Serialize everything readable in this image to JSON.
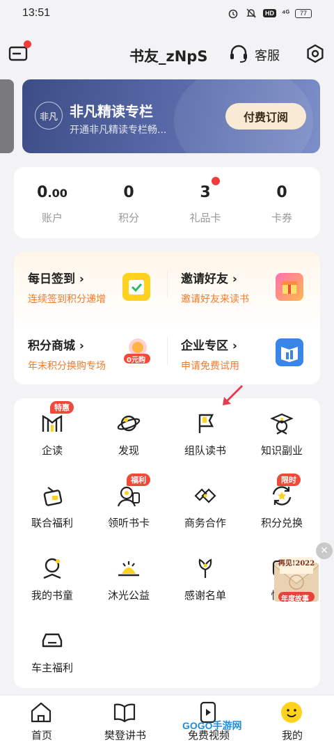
{
  "status_bar": {
    "time": "13:51",
    "signal": "⁴ᴳ",
    "hd": "HD",
    "battery": "77"
  },
  "header": {
    "nickname": "书友_zNpS",
    "service_label": "客服"
  },
  "vip_banner": {
    "logo": "非凡",
    "title": "非凡精读专栏",
    "subtitle": "开通非凡精读专栏畅...",
    "button": "付费订阅"
  },
  "stats": [
    {
      "value": "0",
      "decimal": ".00",
      "label": "账户"
    },
    {
      "value": "0",
      "decimal": "",
      "label": "积分"
    },
    {
      "value": "3",
      "decimal": "",
      "label": "礼品卡"
    },
    {
      "value": "0",
      "decimal": "",
      "label": "卡券"
    }
  ],
  "tasks": [
    {
      "title": "每日签到 ›",
      "subtitle": "连续签到积分递增",
      "icon": "calendar-check-icon"
    },
    {
      "title": "邀请好友 ›",
      "subtitle": "邀请好友来读书",
      "icon": "gift-box-icon"
    },
    {
      "title": "积分商城 ›",
      "subtitle": "年末积分换购专场",
      "icon": "zero-yuan-icon",
      "badge": "0元购"
    },
    {
      "title": "企业专区 ›",
      "subtitle": "申请免费试用",
      "icon": "enterprise-book-icon"
    }
  ],
  "grid": [
    {
      "label": "企读",
      "icon": "enterprise-read-icon",
      "tag": "特惠"
    },
    {
      "label": "发现",
      "icon": "planet-icon",
      "tag": ""
    },
    {
      "label": "组队读书",
      "icon": "flag-icon",
      "tag": ""
    },
    {
      "label": "知识副业",
      "icon": "graduate-icon",
      "tag": ""
    },
    {
      "label": "联合福利",
      "icon": "ticket-icon",
      "tag": ""
    },
    {
      "label": "领听书卡",
      "icon": "listen-card-icon",
      "tag": "福利"
    },
    {
      "label": "商务合作",
      "icon": "handshake-icon",
      "tag": ""
    },
    {
      "label": "积分兑换",
      "icon": "exchange-icon",
      "tag": "限时"
    },
    {
      "label": "我的书童",
      "icon": "book-kid-icon",
      "tag": ""
    },
    {
      "label": "沐光公益",
      "icon": "charity-icon",
      "tag": ""
    },
    {
      "label": "感谢名单",
      "icon": "flower-icon",
      "tag": ""
    },
    {
      "label": "快",
      "icon": "quick-icon",
      "tag": ""
    },
    {
      "label": "车主福利",
      "icon": "car-icon",
      "tag": ""
    }
  ],
  "floating": {
    "line1": "再见!2022",
    "line2": "年度故事"
  },
  "bottom_nav": [
    {
      "label": "首页",
      "icon": "home-icon"
    },
    {
      "label": "樊登讲书",
      "icon": "book-open-icon"
    },
    {
      "label": "免费视频",
      "icon": "video-icon"
    },
    {
      "label": "我的",
      "icon": "smiley-icon"
    }
  ],
  "watermark": "GOGO手游网",
  "colors": {
    "accent_orange": "#f07b2d",
    "badge_red": "#f24a3a",
    "banner_blue": "#3c4d86",
    "brand_yellow": "#ffd21f"
  }
}
